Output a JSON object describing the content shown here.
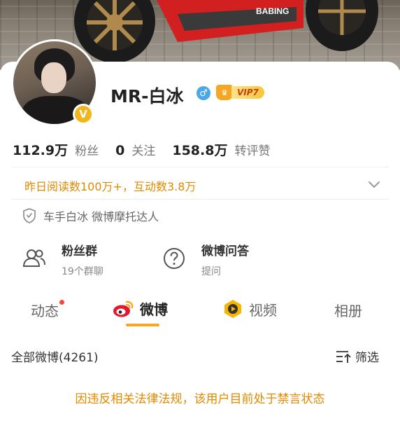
{
  "profile": {
    "name": "MR-白冰",
    "vip_label": "VIP7",
    "verified_badge": "V",
    "gender_symbol": "♂"
  },
  "stats": [
    {
      "value": "112.9万",
      "label": "粉丝"
    },
    {
      "value": "0",
      "label": "关注"
    },
    {
      "value": "158.8万",
      "label": "转评赞"
    }
  ],
  "reads_line": "昨日阅读数100万+，互动数3.8万",
  "certification": "车手白冰 微博摩托达人",
  "features": [
    {
      "title": "粉丝群",
      "subtitle": "19个群聊",
      "icon": "people-icon"
    },
    {
      "title": "微博问答",
      "subtitle": "提问",
      "icon": "question-icon"
    }
  ],
  "tabs": [
    {
      "label": "动态",
      "has_dot": true
    },
    {
      "label": "微博",
      "active": true,
      "icon": "weibo-logo-icon"
    },
    {
      "label": "视频",
      "icon": "video-icon"
    },
    {
      "label": "相册"
    }
  ],
  "posts": {
    "all_label": "全部微博(4261)",
    "filter_label": "筛选"
  },
  "ban_notice": "因违反相关法律法规，该用户目前处于禁言状态",
  "colors": {
    "accent": "#f7a823",
    "notice": "#e08a00",
    "gender": "#4aa8e9"
  }
}
